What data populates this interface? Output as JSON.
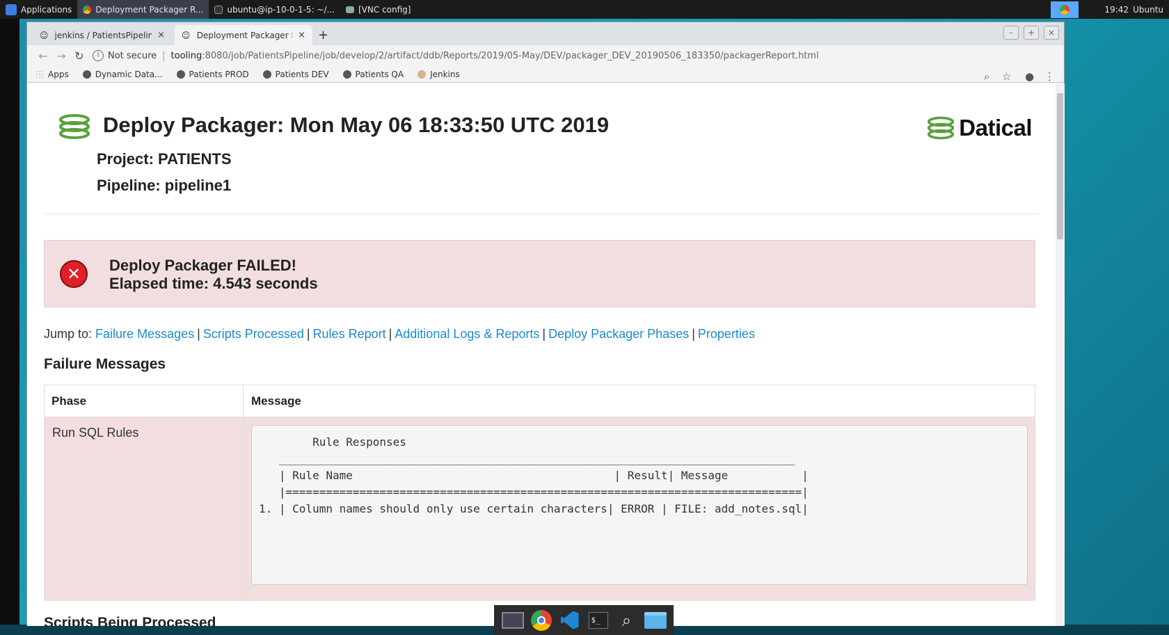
{
  "panel": {
    "applications_label": "Applications",
    "tasks": [
      {
        "label": "Deployment Packager R..."
      },
      {
        "label": "ubuntu@ip-10-0-1-5: ~/..."
      },
      {
        "label": "[VNC config]"
      }
    ],
    "clock": "19:42",
    "user": "Ubuntu"
  },
  "browser": {
    "tabs": [
      {
        "title": "jenkins / PatientsPipeline /"
      },
      {
        "title": "Deployment Packager Rep"
      }
    ],
    "new_tab": "+",
    "window_buttons": {
      "minimize": "–",
      "maximize": "+",
      "close": "×"
    },
    "address": {
      "security": "Not secure",
      "host": "tooling",
      "path": ":8080/job/PatientsPipeline/job/develop/2/artifact/ddb/Reports/2019/05-May/DEV/packager_DEV_20190506_183350/packagerReport.html"
    },
    "bookmarks": [
      {
        "label": "Apps",
        "icon": "apps-grid-icon"
      },
      {
        "label": "Dynamic Data...",
        "icon": "globe-icon"
      },
      {
        "label": "Patients PROD",
        "icon": "globe-icon"
      },
      {
        "label": "Patients DEV",
        "icon": "globe-icon"
      },
      {
        "label": "Patients QA",
        "icon": "globe-icon"
      },
      {
        "label": "Jenkins",
        "icon": "jenkins-icon"
      }
    ]
  },
  "report": {
    "title": "Deploy Packager: Mon May 06 18:33:50 UTC 2019",
    "project": "Project: PATIENTS",
    "pipeline": "Pipeline: pipeline1",
    "brand": "Datical",
    "status": {
      "title": "Deploy Packager FAILED!",
      "elapsed": "Elapsed time: 4.543 seconds",
      "color": "#e21f26"
    },
    "jump": {
      "prefix": "Jump to:",
      "links": [
        "Failure Messages",
        "Scripts Processed",
        "Rules Report",
        "Additional Logs & Reports",
        "Deploy Packager Phases",
        "Properties"
      ]
    },
    "failure_heading": "Failure Messages",
    "table": {
      "headers": [
        "Phase",
        "Message"
      ],
      "rows": [
        {
          "phase": "Run SQL Rules",
          "message_lines": [
            "        Rule Responses",
            "   _____________________________________________________________________________",
            "   | Rule Name                                       | Result| Message           |",
            "   |=============================================================================|",
            "1. | Column names should only use certain characters| ERROR | FILE: add_notes.sql|"
          ]
        }
      ]
    },
    "next_heading_peek": "Scripts Being Processed"
  },
  "dock": [
    "files-icon",
    "chrome-icon",
    "vscode-icon",
    "terminal-icon",
    "search-icon",
    "folder-icon"
  ]
}
